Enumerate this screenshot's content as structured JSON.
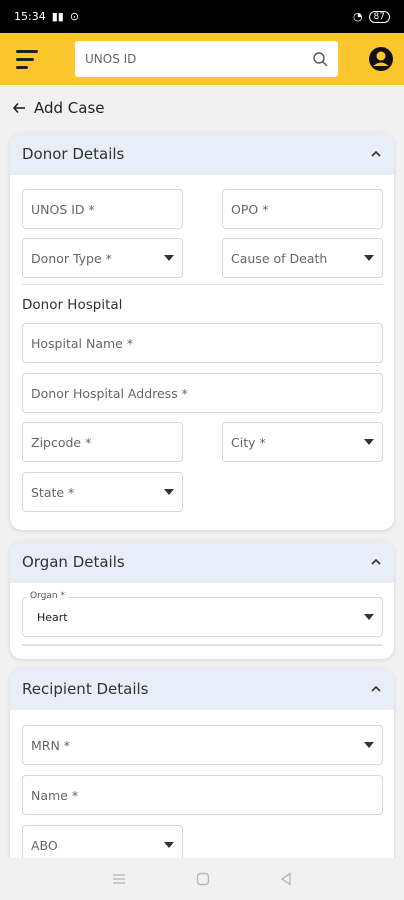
{
  "status_bar": {
    "time": "15:34",
    "battery": "87"
  },
  "header": {
    "search_placeholder": "UNOS ID"
  },
  "page": {
    "back_title": "Add Case"
  },
  "donor_details": {
    "title": "Donor Details",
    "unos_id": "UNOS ID *",
    "opo": "OPO *",
    "donor_type": "Donor Type *",
    "cause_of_death": "Cause of Death",
    "donor_hospital_heading": "Donor Hospital",
    "hospital_name": "Hospital Name *",
    "hospital_address": "Donor Hospital Address *",
    "zipcode": "Zipcode *",
    "city": "City *",
    "state": "State *"
  },
  "organ_details": {
    "title": "Organ Details",
    "organ_label": "Organ *",
    "organ_value": "Heart"
  },
  "recipient_details": {
    "title": "Recipient Details",
    "mrn": "MRN *",
    "name": "Name *",
    "abo": "ABO"
  }
}
